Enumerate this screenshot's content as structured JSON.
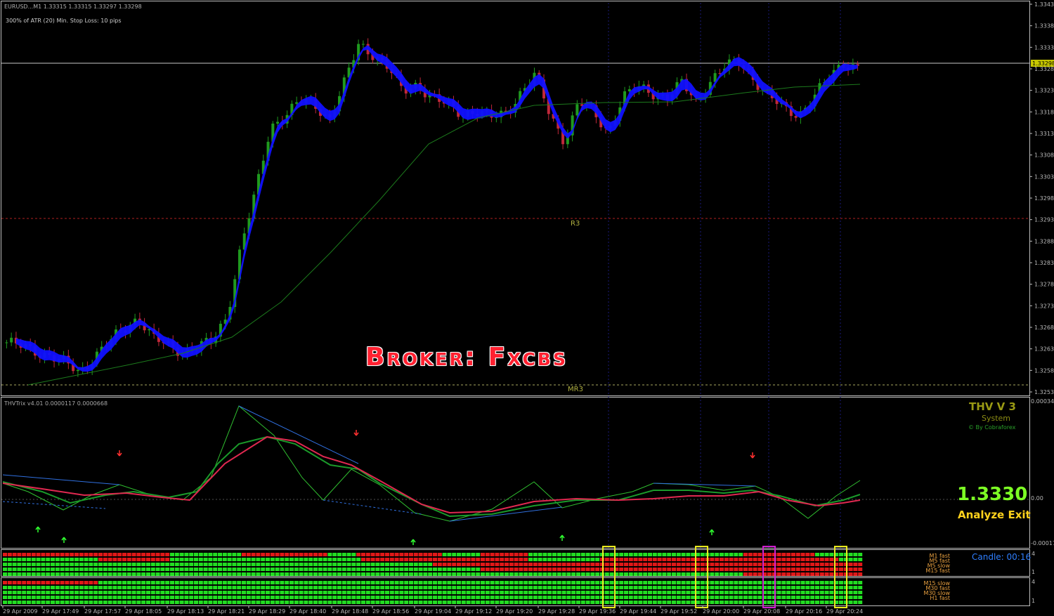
{
  "window": {
    "symbol_line": "EURUSD...M1  1.33315 1.33315 1.33297 1.33298",
    "atr_line": "300% of ATR (20)     Min. Stop Loss:  10 pips"
  },
  "price_axis": {
    "labels": [
      "1.33435",
      "1.33385",
      "1.33335",
      "1.33285",
      "1.33235",
      "1.33185",
      "1.33135",
      "1.33085",
      "1.33035",
      "1.32985",
      "1.32935",
      "1.32885",
      "1.32835",
      "1.32785",
      "1.32735",
      "1.32685",
      "1.32635",
      "1.32585",
      "1.32535"
    ],
    "current": "1.33298"
  },
  "levels": {
    "r3": "R3",
    "mr3": "MR3"
  },
  "watermark": {
    "broker": "Broker: Fxcbs"
  },
  "indicator": {
    "header": "THVTrix v4.01 0.0000117 0.0000668",
    "axis_top": "0.000346",
    "axis_zero": "0.00",
    "axis_bottom": "-0.00017",
    "title": "THV V 3",
    "subtitle": "System",
    "credit": "© By Cobraforex",
    "price": "1.3330",
    "signal": "Analyze Exit"
  },
  "heatmap": {
    "candle_timer": "Candle:  00:16",
    "upper_labels": [
      "M1 fast",
      "M5 fast",
      "M5 slow",
      "M15 fast"
    ],
    "lower_labels": [
      "M15 slow",
      "M30 fast",
      "M30 slow",
      "H1 fast"
    ],
    "upper_axis": [
      "4",
      "1"
    ],
    "lower_axis": [
      "4",
      "1"
    ]
  },
  "time_axis": [
    "29 Apr 2009",
    "29 Apr 17:49",
    "29 Apr 17:57",
    "29 Apr 18:05",
    "29 Apr 18:13",
    "29 Apr 18:21",
    "29 Apr 18:29",
    "29 Apr 18:40",
    "29 Apr 18:48",
    "29 Apr 18:56",
    "29 Apr 19:04",
    "29 Apr 19:12",
    "29 Apr 19:20",
    "29 Apr 19:28",
    "29 Apr 19:36",
    "29 Apr 19:44",
    "29 Apr 19:52",
    "29 Apr 20:00",
    "29 Apr 20:08",
    "29 Apr 20:16",
    "29 Apr 20:24"
  ],
  "colors": {
    "bull": "#1f9a1f",
    "bear": "#c0283a",
    "cloud": "#1010ff",
    "ma": "#1c7a1c",
    "heat_green": "#22dd22",
    "heat_red": "#e01818",
    "marker_yellow": "#e8e820",
    "marker_magenta": "#d020d0"
  },
  "chart_data": {
    "type": "candlestick",
    "title": "EURUSD...M1",
    "ylim": [
      1.32535,
      1.33435
    ],
    "close_path": [
      1.3265,
      1.3264,
      1.3263,
      1.3262,
      1.326,
      1.3258,
      1.3262,
      1.3265,
      1.3268,
      1.3271,
      1.3266,
      1.3264,
      1.3263,
      1.3264,
      1.3265,
      1.3271,
      1.3288,
      1.33,
      1.3315,
      1.3318,
      1.3321,
      1.332,
      1.3317,
      1.3325,
      1.3334,
      1.3332,
      1.3329,
      1.3323,
      1.3325,
      1.3322,
      1.332,
      1.3318,
      1.3319,
      1.3317,
      1.3318,
      1.3323,
      1.3327,
      1.3318,
      1.3312,
      1.3321,
      1.3318,
      1.3314,
      1.3322,
      1.3324,
      1.3323,
      1.3322,
      1.3325,
      1.3321,
      1.3326,
      1.3329,
      1.333,
      1.3326,
      1.3322,
      1.3319,
      1.3318,
      1.3322,
      1.3326,
      1.333,
      1.3329
    ]
  }
}
